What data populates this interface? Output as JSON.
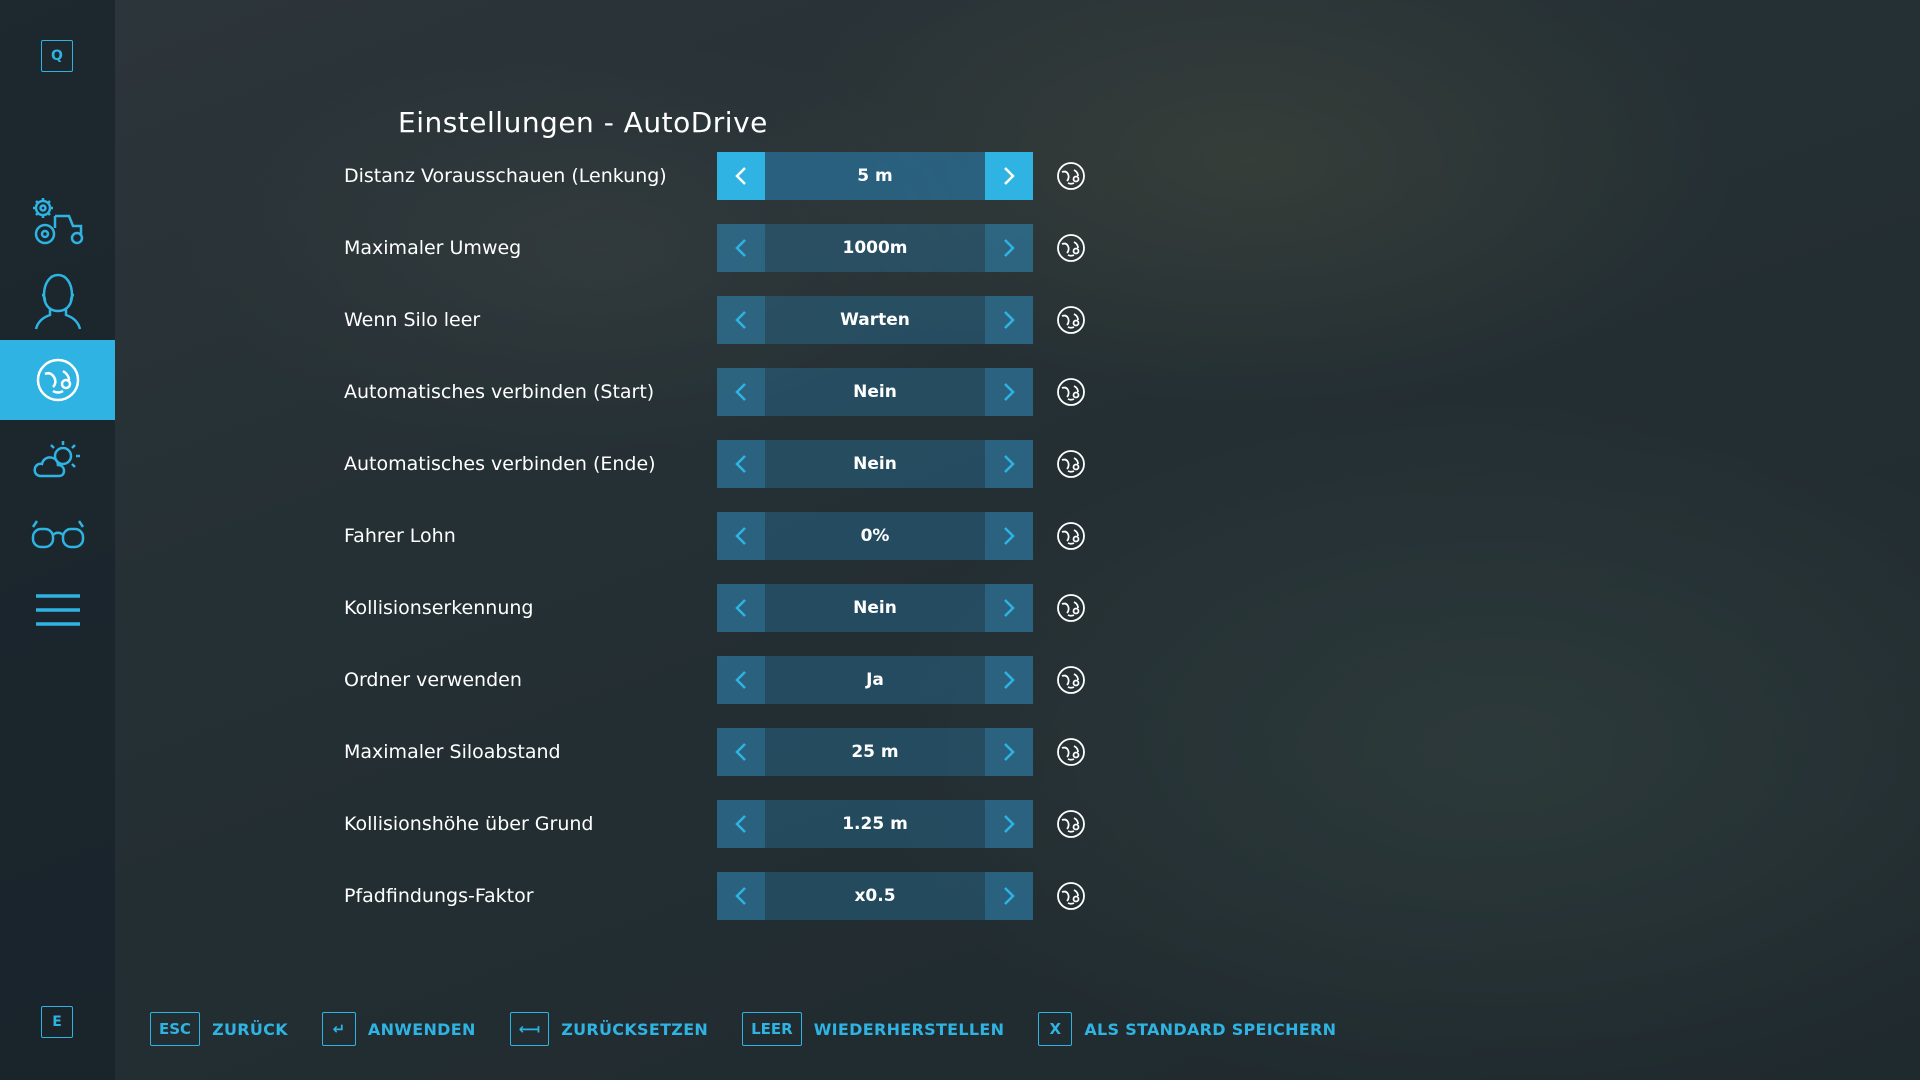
{
  "colors": {
    "accent": "#2fb3e3",
    "text": "#ffffff"
  },
  "sidebar": {
    "top_key": "Q",
    "bottom_key": "E",
    "items": [
      {
        "icon": "tractor-gear-icon",
        "active": false
      },
      {
        "icon": "farmer-head-icon",
        "active": false
      },
      {
        "icon": "autodrive-icon",
        "active": true
      },
      {
        "icon": "weather-icon",
        "active": false
      },
      {
        "icon": "glasses-icon",
        "active": false
      },
      {
        "icon": "menu-icon",
        "active": false
      }
    ]
  },
  "title": "Einstellungen - AutoDrive",
  "settings": [
    {
      "label": "Distanz Vorausschauen (Lenkung)",
      "value": "5 m"
    },
    {
      "label": "Maximaler Umweg",
      "value": "1000m"
    },
    {
      "label": "Wenn Silo leer",
      "value": "Warten"
    },
    {
      "label": "Automatisches verbinden (Start)",
      "value": "Nein"
    },
    {
      "label": "Automatisches verbinden (Ende)",
      "value": "Nein"
    },
    {
      "label": "Fahrer Lohn",
      "value": "0%"
    },
    {
      "label": "Kollisionserkennung",
      "value": "Nein"
    },
    {
      "label": "Ordner verwenden",
      "value": "Ja"
    },
    {
      "label": "Maximaler Siloabstand",
      "value": "25 m"
    },
    {
      "label": "Kollisionshöhe über Grund",
      "value": "1.25 m"
    },
    {
      "label": "Pfadfindungs-Faktor",
      "value": "x0.5"
    }
  ],
  "footer": [
    {
      "key": "ESC",
      "label": "ZURÜCK"
    },
    {
      "key": "↵",
      "label": "ANWENDEN"
    },
    {
      "key": "⟻",
      "label": "ZURÜCKSETZEN"
    },
    {
      "key": "LEER",
      "label": "WIEDERHERSTELLEN"
    },
    {
      "key": "X",
      "label": "ALS STANDARD SPEICHERN"
    }
  ]
}
